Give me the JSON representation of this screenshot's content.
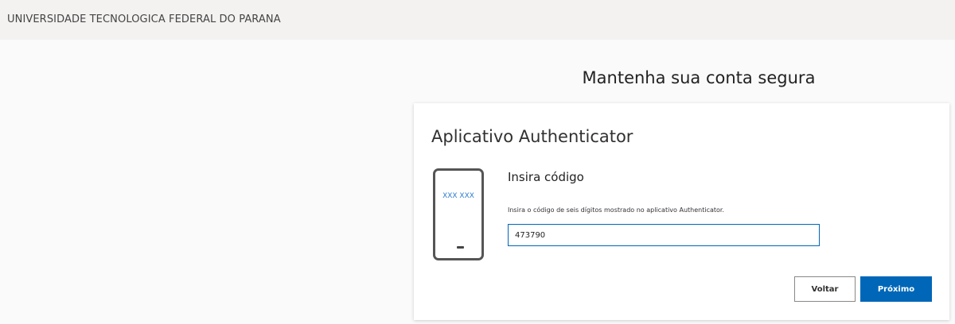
{
  "header": {
    "org_name": "UNIVERSIDADE TECNOLOGICA FEDERAL DO PARANA"
  },
  "page": {
    "heading": "Mantenha sua conta segura"
  },
  "card": {
    "title": "Aplicativo Authenticator",
    "phone_code": "XXX XXX",
    "enter_code_title": "Insira código",
    "instruction": "Insira o código de seis dígitos mostrado no aplicativo Authenticator.",
    "code_value": "473790",
    "back_label": "Voltar",
    "next_label": "Próximo"
  },
  "icons": {
    "phone": "phone-icon"
  },
  "colors": {
    "accent": "#0067b8",
    "phone_code": "#2b7cd3",
    "header_bg": "#f3f2f1"
  }
}
